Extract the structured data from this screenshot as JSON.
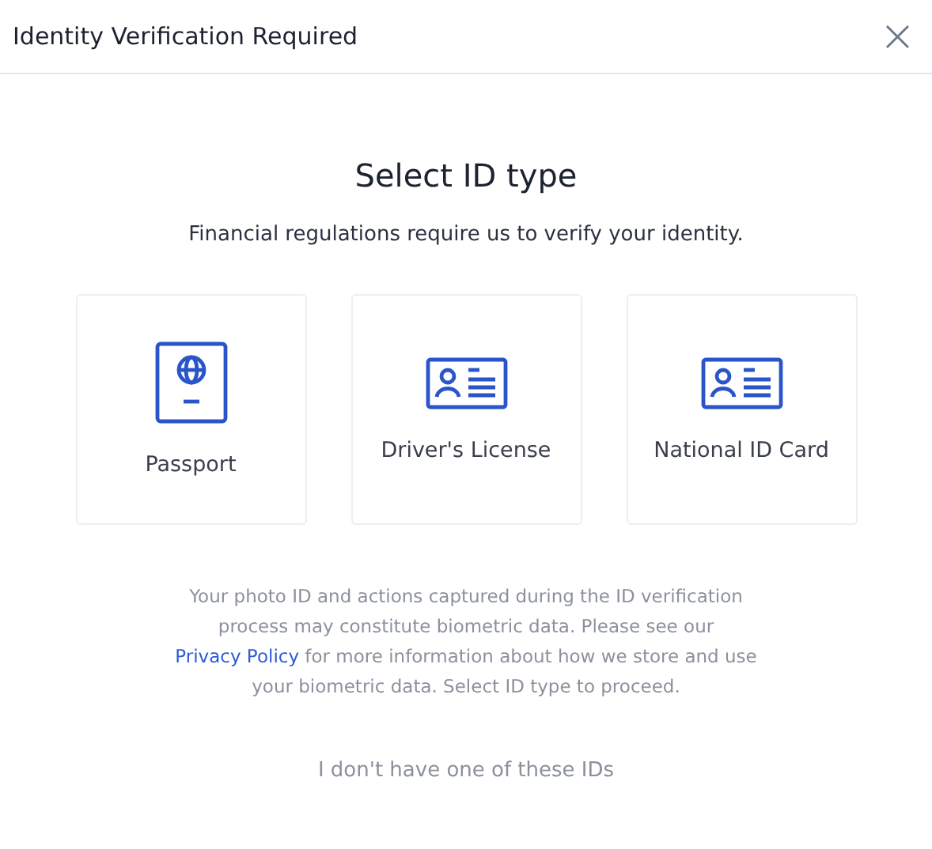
{
  "dialog": {
    "title": "Identity Verification Required",
    "close": "×"
  },
  "heading": "Select ID type",
  "subtitle": "Financial regulations require us to verify your identity.",
  "options": [
    {
      "kind": "passport",
      "label": "Passport"
    },
    {
      "kind": "id_card",
      "label": "Driver's License"
    },
    {
      "kind": "id_card",
      "label": "National ID Card"
    }
  ],
  "disclaimer": {
    "before": "Your photo ID and actions captured during the ID verification process may constitute biometric data. Please see our",
    "link": "Privacy Policy",
    "after": "for more information about how we store and use your biometric data. Select ID type to proceed."
  },
  "alternate_link": "I don't have one of these IDs"
}
